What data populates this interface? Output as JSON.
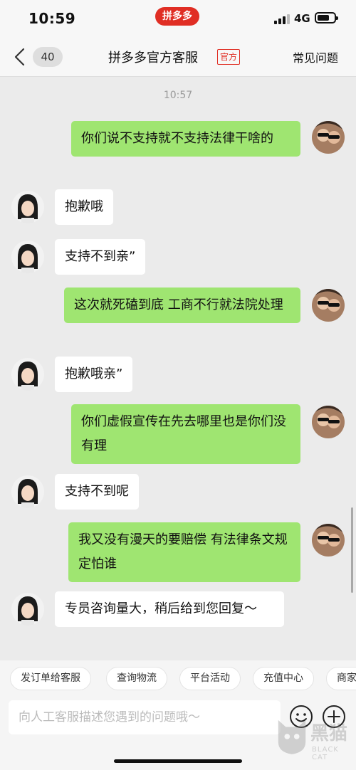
{
  "status_bar": {
    "time": "10:59",
    "app_name": "拼多多",
    "network": "4G"
  },
  "nav": {
    "unread_count": "40",
    "title": "拼多多官方客服",
    "official_tag": "官方",
    "faq_label": "常见问题"
  },
  "chat": {
    "timestamp": "10:57",
    "messages": [
      {
        "side": "out",
        "text": "你们说不支持就不支持法律干啥的"
      },
      {
        "side": "in",
        "text": "抱歉哦"
      },
      {
        "side": "in",
        "text": "支持不到亲ˮ"
      },
      {
        "side": "out",
        "text": "这次就死磕到底  工商不行就法院处理"
      },
      {
        "side": "in",
        "text": "抱歉哦亲ˮ"
      },
      {
        "side": "out",
        "text": "你们虚假宣传在先去哪里也是你们没有理"
      },
      {
        "side": "in",
        "text": "支持不到呢"
      },
      {
        "side": "out",
        "text": "我又没有漫天的要赔偿 有法律条文规定怕谁"
      },
      {
        "side": "in",
        "text": "专员咨询量大，稍后给到您回复～"
      }
    ]
  },
  "quick_actions": [
    "发订单给客服",
    "查询物流",
    "平台活动",
    "充值中心",
    "商家"
  ],
  "input": {
    "placeholder": "向人工客服描述您遇到的问题哦～"
  },
  "icons": {
    "back": "chevron-left-icon",
    "emoji": "smiley-icon",
    "add": "plus-circle-icon"
  },
  "watermark": {
    "text": "黑猫",
    "sub": "BLACK CAT"
  },
  "colors": {
    "brand_red": "#e02e24",
    "outgoing_bubble": "#9fe571",
    "incoming_bubble": "#ffffff",
    "chat_background": "#ebebeb"
  }
}
